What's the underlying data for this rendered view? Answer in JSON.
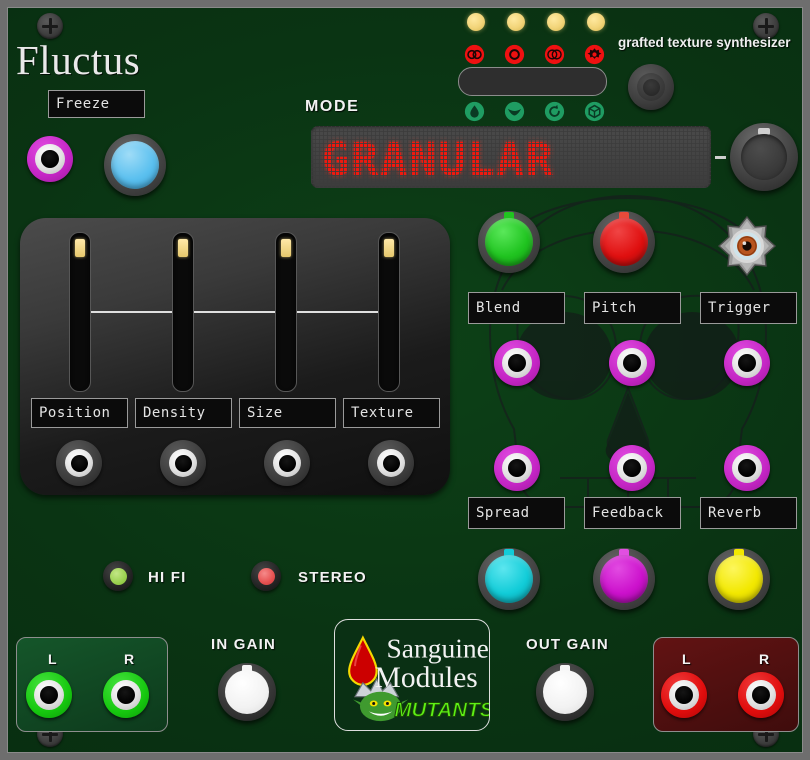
{
  "module": {
    "brand": "Fluctus",
    "tagline": "grafted texture synthesizer",
    "mode_label": "MODE",
    "display_value": "GRANULAR",
    "display_placeholder": "GRANULAR"
  },
  "freeze": {
    "label": "Freeze"
  },
  "sliders": [
    {
      "label": "Position",
      "value": 96
    },
    {
      "label": "Density",
      "value": 96
    },
    {
      "label": "Size",
      "value": 96
    },
    {
      "label": "Texture",
      "value": 96
    }
  ],
  "leds": {
    "top_icons": [
      "dual-circle-icon",
      "circle-icon",
      "overlap-circle-icon",
      "gear-circle-icon"
    ],
    "top_icon_color": "#ee1111",
    "bar_leds": [
      "on",
      "on",
      "on",
      "on"
    ],
    "bar_led_color": "#f2d479",
    "bottom_icons": [
      "droplet-icon",
      "alien-eyes-icon",
      "rotate-icon",
      "cube-icon"
    ],
    "bottom_icon_color": "#1f9c62"
  },
  "controls": {
    "blend": {
      "label": "Blend",
      "color": "#20c420"
    },
    "pitch": {
      "label": "Pitch",
      "color": "#e01010"
    },
    "trigger": {
      "label": "Trigger",
      "icon": "eyeball-icon"
    },
    "spread": {
      "label": "Spread",
      "color": "#c425c4"
    },
    "feedback": {
      "label": "Feedback",
      "color": "#c425c4"
    },
    "reverb": {
      "label": "Reverb",
      "color": "#c425c4"
    }
  },
  "bottom_knobs": [
    {
      "name": "cyan-knob",
      "color": "#12ccd8"
    },
    {
      "name": "magenta-knob",
      "color": "#cc11cc"
    },
    {
      "name": "yellow-knob",
      "color": "#f2e800"
    }
  ],
  "indicators": [
    {
      "label": "HI FI",
      "color": "#9ad14f",
      "state": "on"
    },
    {
      "label": "STEREO",
      "color": "#e65050",
      "state": "on"
    }
  ],
  "io": {
    "in_gain_label": "IN GAIN",
    "out_gain_label": "OUT GAIN",
    "input": {
      "left": "L",
      "right": "R"
    },
    "output": {
      "left": "L",
      "right": "R"
    }
  },
  "logo": {
    "line1": "Sanguine",
    "line2": "Modules",
    "badge": "MUTANTS"
  },
  "colors": {
    "panel_green": "#0a3413",
    "display_red": "#f0190f",
    "magenta": "#c425c4",
    "jack_green": "#16c80f",
    "jack_red": "#e00c0c"
  }
}
